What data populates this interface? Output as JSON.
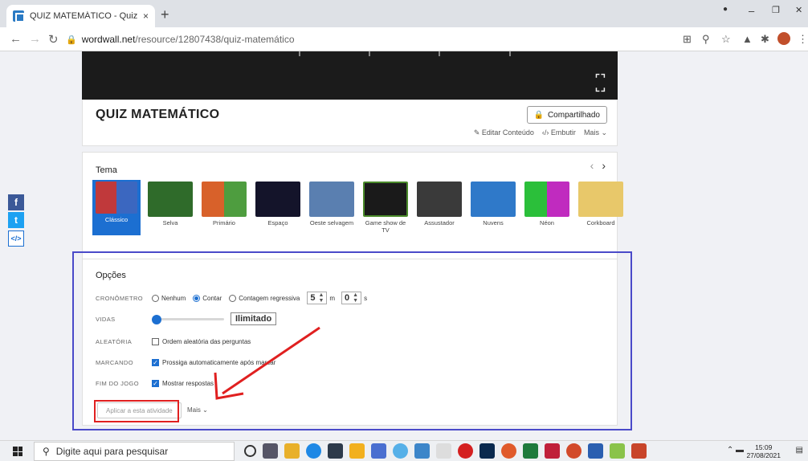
{
  "browser": {
    "tab_title": "QUIZ MATEMÁTICO - Quiz Game",
    "tab_close": "×",
    "new_tab": "+",
    "url_host": "wordwall.net",
    "url_path": "/resource/12807438/quiz-matemático",
    "window_controls": {
      "minimize": "–",
      "restore": "❐",
      "close": "✕"
    }
  },
  "page": {
    "quiz_title": "QUIZ MATEMÁTICO",
    "share_label": "Compartilhado",
    "links": {
      "edit": "Editar Conteúdo",
      "embed": "Embutir",
      "more": "Mais"
    },
    "theme_label": "Tema",
    "themes": [
      {
        "name": "Clássico",
        "selected": true
      },
      {
        "name": "Selva"
      },
      {
        "name": "Primário"
      },
      {
        "name": "Espaço"
      },
      {
        "name": "Oeste selvagem"
      },
      {
        "name": "Game show de TV"
      },
      {
        "name": "Assustador"
      },
      {
        "name": "Nuvens"
      },
      {
        "name": "Néon"
      },
      {
        "name": "Corkboard"
      }
    ],
    "options": {
      "title": "Opções",
      "timer_label": "CRONÔMETRO",
      "timer_none": "Nenhum",
      "timer_count": "Contar",
      "timer_countdown": "Contagem regressiva",
      "minutes_value": "5",
      "minutes_unit": "m",
      "seconds_value": "0",
      "seconds_unit": "s",
      "lives_label": "VIDAS",
      "lives_value": "Ilimitado",
      "random_label": "ALEATÓRIA",
      "random_option": "Ordem aleatória das perguntas",
      "marking_label": "MARCANDO",
      "marking_option": "Prossiga automaticamente após marcar",
      "end_label": "FIM DO JOGO",
      "end_option": "Mostrar respostas",
      "apply_button": "Aplicar a esta atividade",
      "more_link": "Mais"
    }
  },
  "taskbar": {
    "search_placeholder": "Digite aqui para pesquisar",
    "time": "15:09",
    "date": "27/08/2021"
  }
}
